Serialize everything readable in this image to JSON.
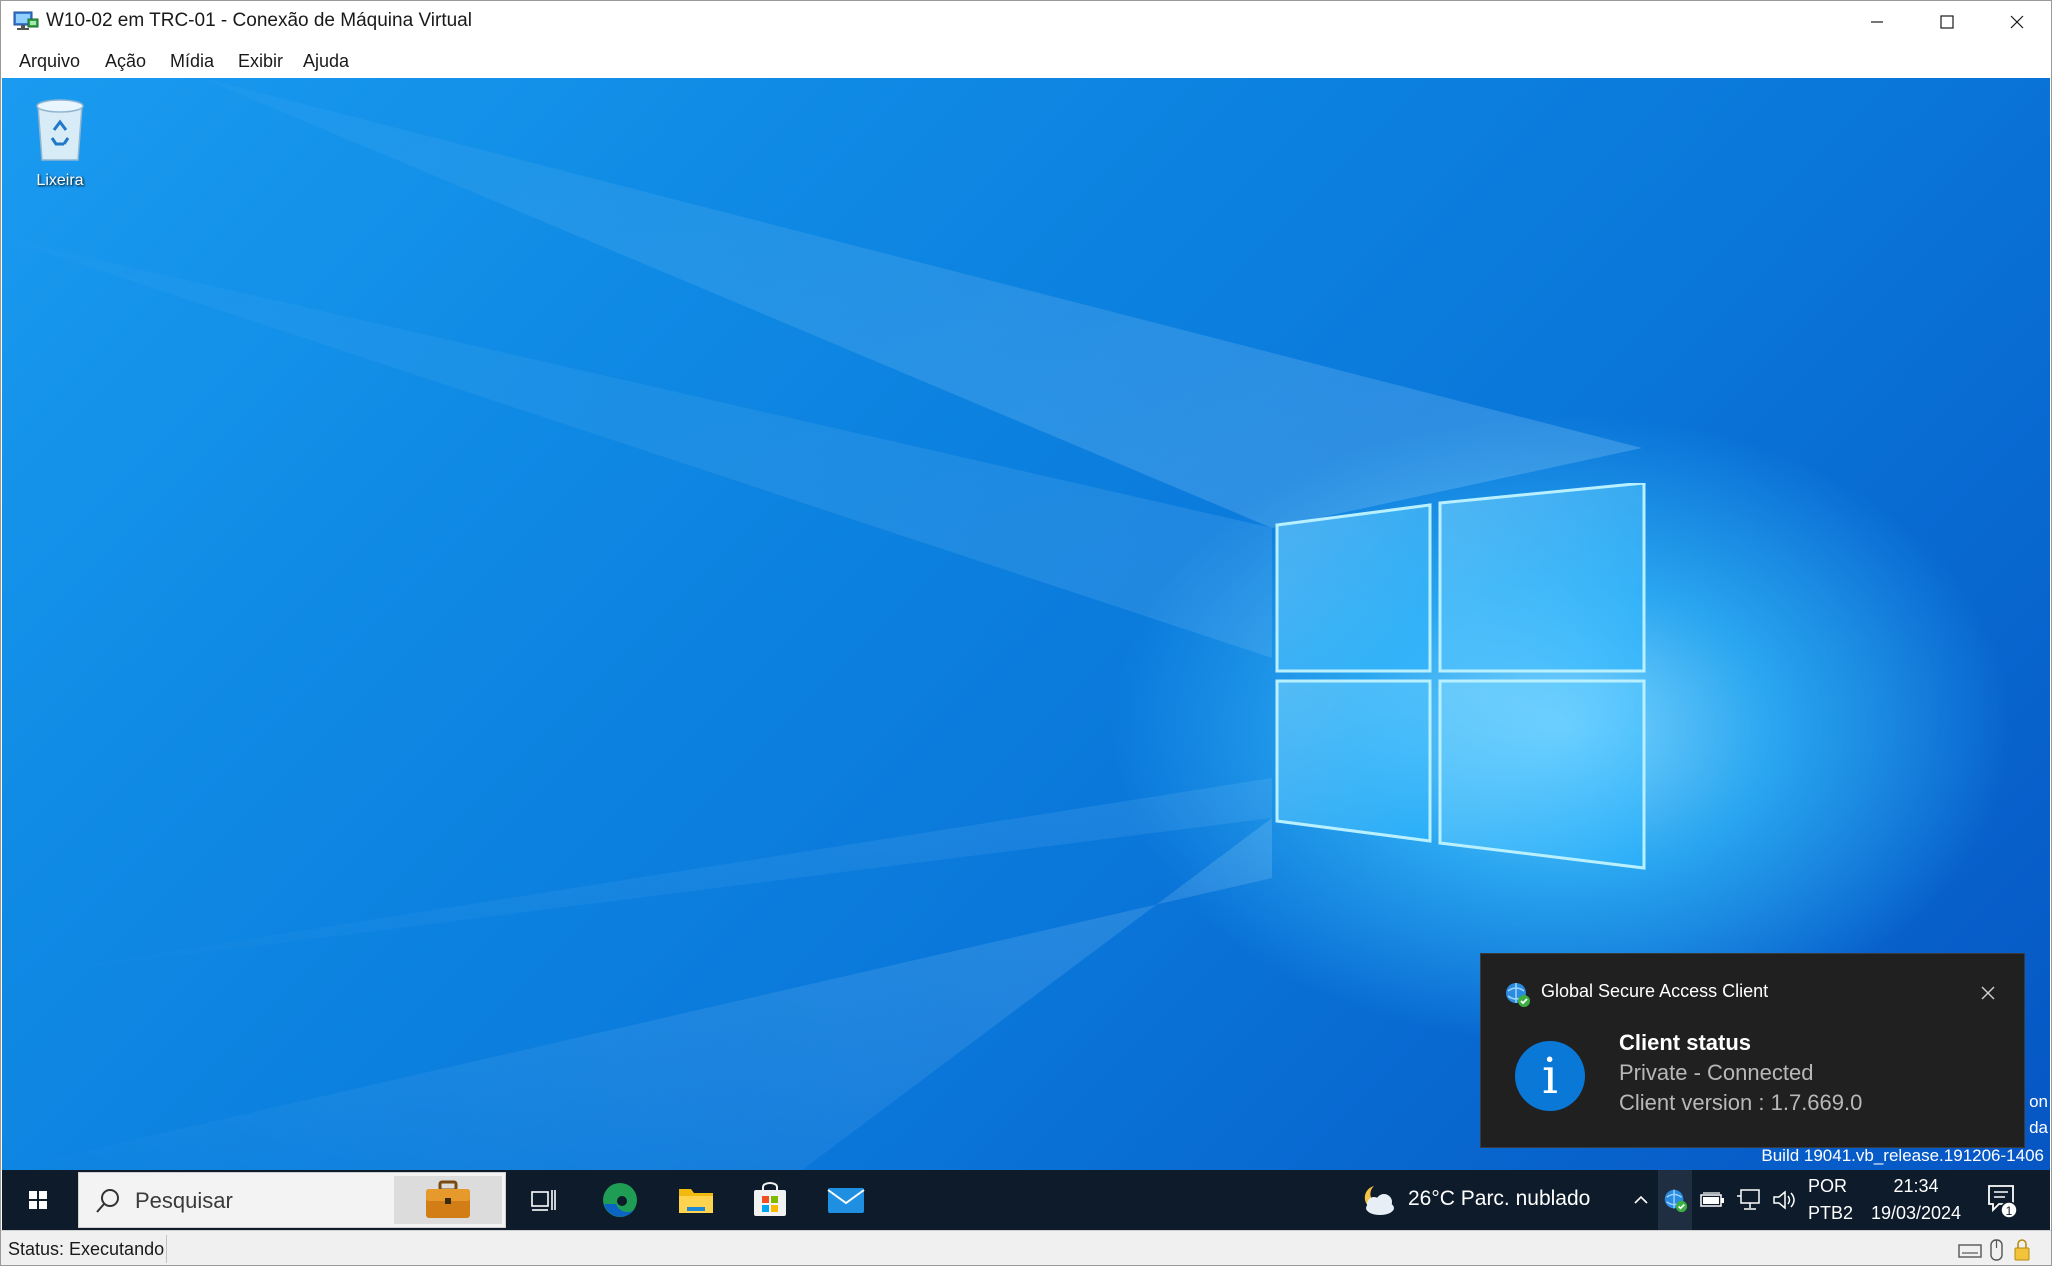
{
  "window": {
    "title": "W10-02 em TRC-01 - Conexão de Máquina Virtual",
    "icon": "vm-connection-icon",
    "controls": {
      "minimize": "minimize-icon",
      "maximize": "maximize-icon",
      "close": "close-icon"
    }
  },
  "menu": {
    "items": [
      {
        "label": "Arquivo"
      },
      {
        "label": "Ação"
      },
      {
        "label": "Mídia"
      },
      {
        "label": "Exibir"
      },
      {
        "label": "Ajuda"
      }
    ]
  },
  "desktop": {
    "icons": [
      {
        "label": "Lixeira",
        "icon": "recycle-bin-icon"
      }
    ],
    "watermark": {
      "line1": "on",
      "line2": "da",
      "build": "Build 19041.vb_release.191206-1406"
    }
  },
  "toast": {
    "app_name": "Global Secure Access Client",
    "app_icon": "globe-check-icon",
    "title": "Client status",
    "line1": "Private - Connected",
    "line2": "Client version : 1.7.669.0",
    "info_glyph": "i"
  },
  "taskbar": {
    "search_placeholder": "Pesquisar",
    "apps": [
      "briefcase-icon",
      "task-view-icon",
      "edge-icon",
      "file-explorer-icon",
      "store-icon",
      "mail-icon"
    ],
    "weather": {
      "text": "26°C  Parc. nublado",
      "icon": "partly-cloudy-night-icon"
    },
    "tray_icons": [
      "chevron-up-icon",
      "globe-check-icon",
      "battery-icon",
      "network-icon",
      "volume-icon"
    ],
    "lang_line1": "POR",
    "lang_line2": "PTB2",
    "time": "21:34",
    "date": "19/03/2024",
    "notification_count": "1"
  },
  "statusbar": {
    "text": "Status: Executando"
  },
  "colors": {
    "accent": "#0a78d7",
    "taskbar": "#0d1b2a",
    "toast_bg": "#202020"
  }
}
